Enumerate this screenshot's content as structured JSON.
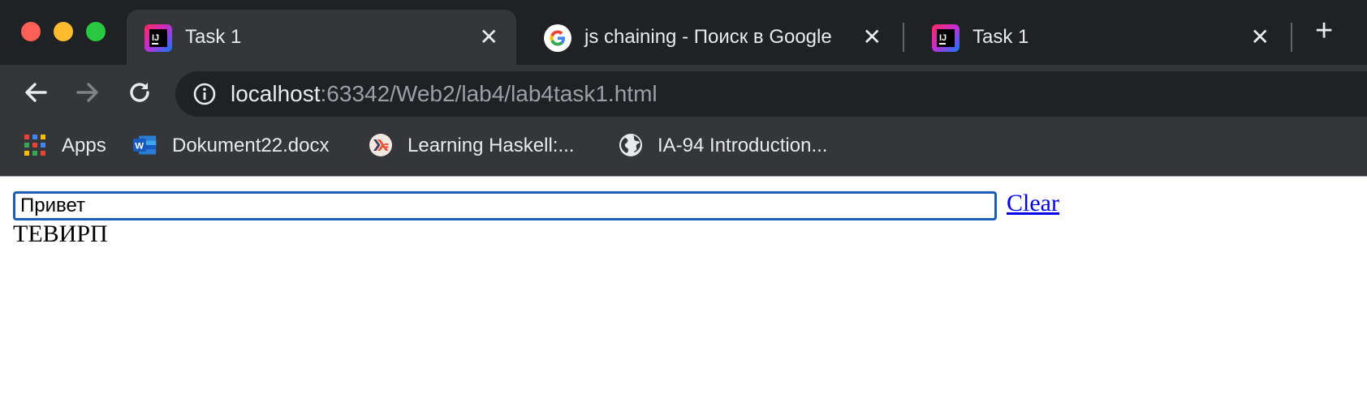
{
  "browser": {
    "tabs": [
      {
        "title": "Task 1",
        "favicon": "intellij-icon",
        "active": true
      },
      {
        "title": "js chaining - Поиск в Google",
        "favicon": "google-icon",
        "active": false
      },
      {
        "title": "Task 1",
        "favicon": "intellij-icon",
        "active": false
      }
    ],
    "close_glyph": "✕",
    "newtab_glyph": "+",
    "address": {
      "host": "localhost",
      "rest": ":63342/Web2/lab4/lab4task1.html"
    },
    "bookmarks": [
      {
        "label": "Apps",
        "icon": "apps-grid-icon"
      },
      {
        "label": "Dokument22.docx",
        "icon": "word-icon"
      },
      {
        "label": "Learning Haskell:...",
        "icon": "haskell-icon"
      },
      {
        "label": "IA-94 Introduction...",
        "icon": "globe-icon"
      }
    ]
  },
  "page": {
    "input_value": "Привет",
    "clear_label": "Clear",
    "output_text": "ТЕВИРП"
  },
  "colors": {
    "tab_strip": "#202124",
    "toolbar": "#35363a",
    "input_border": "#1a5fb4",
    "link": "#0000ee"
  }
}
